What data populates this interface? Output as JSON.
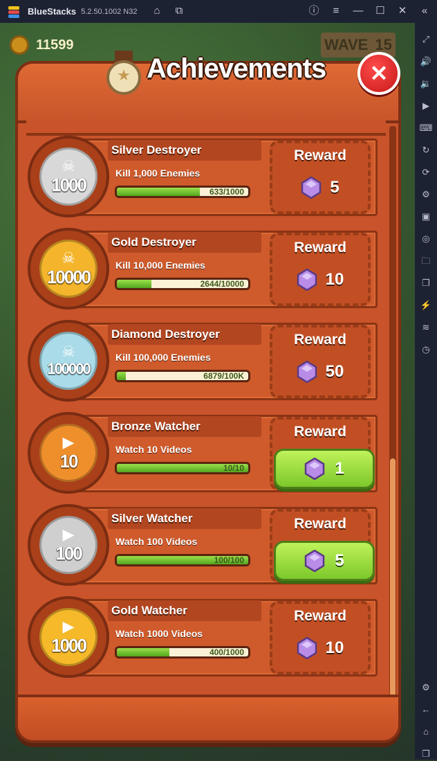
{
  "emulator": {
    "app_name": "BlueStacks",
    "version": "5.2.50.1002 N32"
  },
  "game": {
    "coins": "11599",
    "wave_label": "WAVE",
    "wave_number": "15"
  },
  "panel": {
    "title": "Achievements",
    "close_label": "✕"
  },
  "achievements": [
    {
      "name": "Silver Destroyer",
      "desc": "Kill 1,000 Enemies",
      "badge": "1000",
      "badge_glyph": "☠",
      "badge_color": "#d8d8d8",
      "progress_text": "633/1000",
      "progress": 0.633,
      "reward_label": "Reward",
      "reward": "5",
      "claimable": false
    },
    {
      "name": "Gold Destroyer",
      "desc": "Kill 10,000 Enemies",
      "badge": "10000",
      "badge_glyph": "☠",
      "badge_color": "#f4b52c",
      "progress_text": "2644/10000",
      "progress": 0.2644,
      "reward_label": "Reward",
      "reward": "10",
      "claimable": false
    },
    {
      "name": "Diamond Destroyer",
      "desc": "Kill 100,000 Enemies",
      "badge": "100000",
      "badge_glyph": "☠",
      "badge_color": "#a9dbe8",
      "progress_text": "6879/100K",
      "progress": 0.06879,
      "reward_label": "Reward",
      "reward": "50",
      "claimable": false
    },
    {
      "name": "Bronze Watcher",
      "desc": "Watch 10 Videos",
      "badge": "10",
      "badge_glyph": "▶",
      "badge_color": "#ef8f2c",
      "progress_text": "10/10",
      "progress": 1.0,
      "reward_label": "Reward",
      "reward": "1",
      "claimable": true
    },
    {
      "name": "Silver Watcher",
      "desc": "Watch 100 Videos",
      "badge": "100",
      "badge_glyph": "▶",
      "badge_color": "#cfcfcf",
      "progress_text": "100/100",
      "progress": 1.0,
      "reward_label": "Reward",
      "reward": "5",
      "claimable": true
    },
    {
      "name": "Gold Watcher",
      "desc": "Watch 1000 Videos",
      "badge": "1000",
      "badge_glyph": "▶",
      "badge_color": "#f6b92a",
      "progress_text": "400/1000",
      "progress": 0.4,
      "reward_label": "Reward",
      "reward": "10",
      "claimable": false
    }
  ],
  "gem_color": "#b98ce8",
  "sidebar_icons": [
    "fullscreen-icon",
    "volume-up-icon",
    "volume-down-icon",
    "media-icon",
    "keyboard-icon",
    "rotate-icon",
    "sync-icon",
    "macro-icon",
    "apk-icon",
    "screenshot-icon",
    "folder-icon",
    "multi-instance-icon",
    "eco-mode-icon",
    "layers-icon",
    "performance-icon",
    "settings-icon",
    "back-icon",
    "home-icon",
    "recent-apps-icon"
  ]
}
